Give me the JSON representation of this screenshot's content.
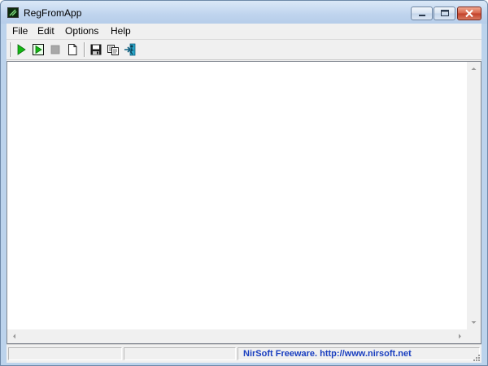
{
  "window": {
    "title": "RegFromApp",
    "app_icon": "regfromapp-app-icon"
  },
  "menu": {
    "items": [
      {
        "label": "File"
      },
      {
        "label": "Edit"
      },
      {
        "label": "Options"
      },
      {
        "label": "Help"
      }
    ]
  },
  "toolbar": {
    "buttons": [
      {
        "icon": "play-icon"
      },
      {
        "icon": "play-selected-icon"
      },
      {
        "icon": "stop-icon"
      },
      {
        "icon": "new-document-icon"
      },
      {
        "icon": "save-icon"
      },
      {
        "icon": "copy-icon"
      },
      {
        "icon": "exit-icon"
      }
    ]
  },
  "statusbar": {
    "panels": [
      "",
      ""
    ],
    "link_text": "NirSoft Freeware.  http://www.nirsoft.net",
    "link_color": "#1a3fc0"
  },
  "colors": {
    "titlebar": "#bfd4ee",
    "close_button": "#c2402a",
    "client_background": "#f0f0f0",
    "list_background": "#ffffff"
  }
}
